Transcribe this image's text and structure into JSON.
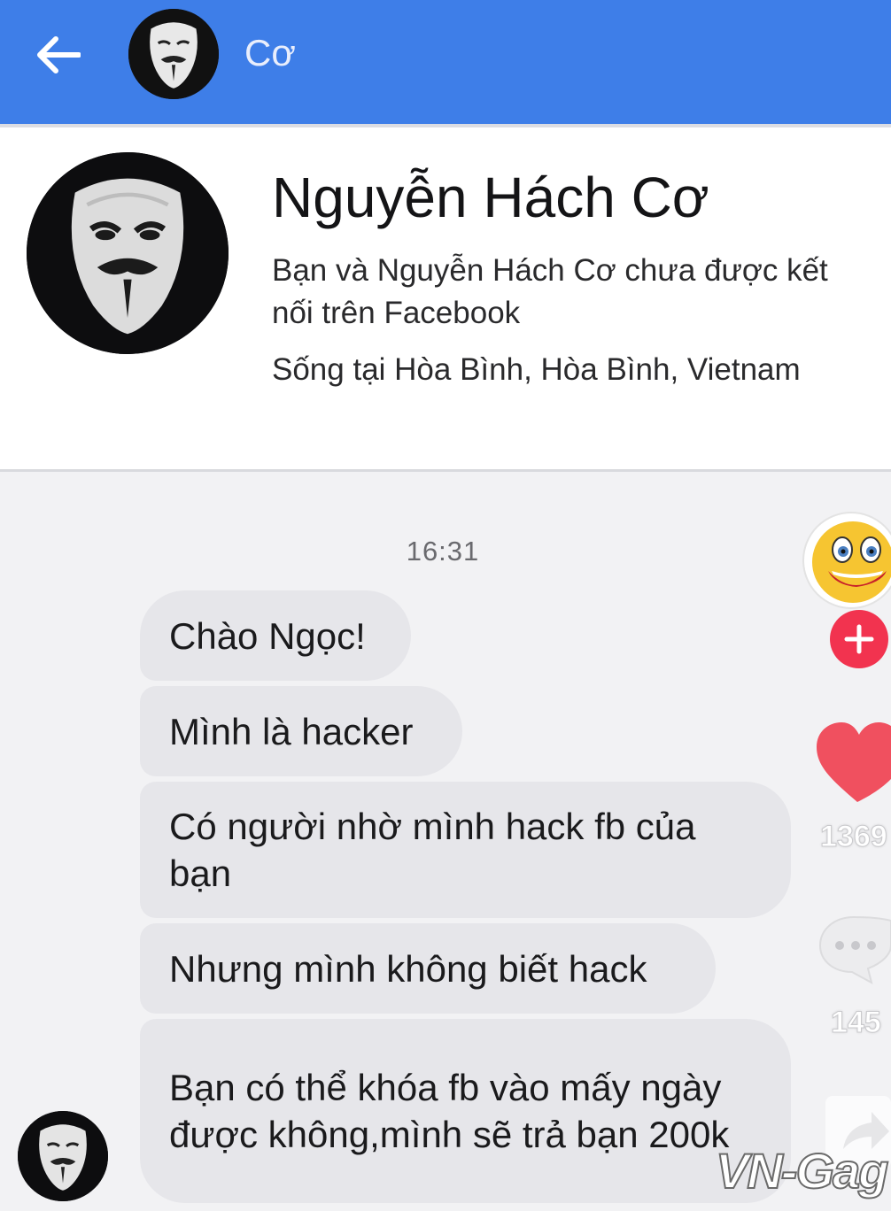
{
  "header": {
    "title": "Cơ",
    "accent_color": "#3e7ee8"
  },
  "profile": {
    "name": "Nguyễn Hách Cơ",
    "connection_text": "Bạn và Nguyễn Hách Cơ chưa được kết nối trên Facebook",
    "location_text": "Sống tại Hòa Bình, Hòa Bình, Vietnam"
  },
  "chat": {
    "timestamp": "16:31",
    "messages": [
      {
        "text": "Chào Ngọc!"
      },
      {
        "text": "Mình là hacker"
      },
      {
        "text": "Có người nhờ mình hack fb của bạn"
      },
      {
        "text": "Nhưng mình không biết hack"
      },
      {
        "text": "Bạn có thể khóa fb vào mấy ngày được không,mình sẽ trả bạn 200k"
      }
    ]
  },
  "overlay": {
    "like_count": "1369",
    "comment_count": "145",
    "watermark": "VN-Gag",
    "icons": [
      "laughing-emoji-avatar",
      "plus-icon",
      "heart-icon",
      "comment-bubble-icon",
      "share-icon"
    ]
  }
}
